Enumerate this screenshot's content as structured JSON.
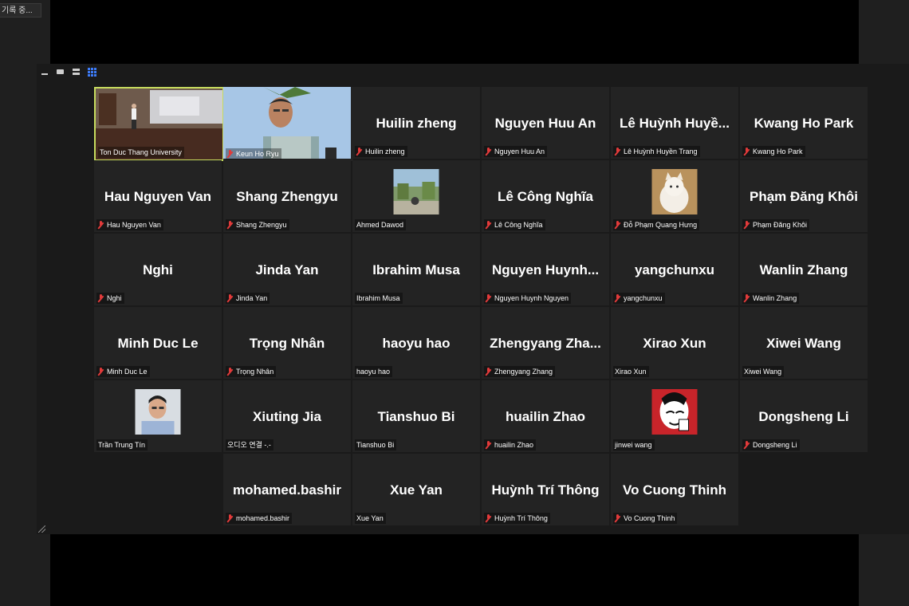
{
  "recording_badge": "기록 중...",
  "window": {
    "view_controls": [
      "minimize",
      "speaker-view",
      "strip-view",
      "gallery-view"
    ]
  },
  "participants": [
    {
      "name": "Ton Duc Thang University",
      "big": "",
      "muted": false,
      "video": "classroom",
      "active": true
    },
    {
      "name": "Keun Ho Ryu",
      "big": "",
      "muted": true,
      "video": "man-outdoor"
    },
    {
      "name": "Huilin zheng",
      "big": "Huilin zheng",
      "muted": true
    },
    {
      "name": "Nguyen Huu An",
      "big": "Nguyen Huu An",
      "muted": true
    },
    {
      "name": "Lê Huỳnh Huyền Trang",
      "big": "Lê Huỳnh Huyề...",
      "muted": true
    },
    {
      "name": "Kwang Ho Park",
      "big": "Kwang Ho Park",
      "muted": true
    },
    {
      "name": "Hau Nguyen Van",
      "big": "Hau Nguyen Van",
      "muted": true
    },
    {
      "name": "Shang Zhengyu",
      "big": "Shang Zhengyu",
      "muted": true
    },
    {
      "name": "Ahmed Dawod",
      "big": "",
      "muted": false,
      "thumb": "garden"
    },
    {
      "name": "Lê Công Nghĩa",
      "big": "Lê Công Nghĩa",
      "muted": true
    },
    {
      "name": "Đỗ Phạm Quang Hưng",
      "big": "",
      "muted": true,
      "thumb": "cat"
    },
    {
      "name": "Phạm Đăng Khôi",
      "big": "Phạm Đăng Khôi",
      "muted": true
    },
    {
      "name": "Nghi",
      "big": "Nghi",
      "muted": true
    },
    {
      "name": "Jinda Yan",
      "big": "Jinda Yan",
      "muted": true
    },
    {
      "name": "Ibrahim Musa",
      "big": "Ibrahim Musa",
      "muted": false
    },
    {
      "name": "Nguyen Huynh Nguyen",
      "big": "Nguyen  Huynh...",
      "muted": true
    },
    {
      "name": "yangchunxu",
      "big": "yangchunxu",
      "muted": true
    },
    {
      "name": "Wanlin Zhang",
      "big": "Wanlin Zhang",
      "muted": true
    },
    {
      "name": "Minh Duc Le",
      "big": "Minh Duc Le",
      "muted": true
    },
    {
      "name": "Trọng Nhân",
      "big": "Trọng Nhân",
      "muted": true
    },
    {
      "name": "haoyu hao",
      "big": "haoyu hao",
      "muted": false
    },
    {
      "name": "Zhengyang Zhang",
      "big": "Zhengyang  Zha...",
      "muted": true
    },
    {
      "name": "Xirao Xun",
      "big": "Xirao Xun",
      "muted": false
    },
    {
      "name": "Xiwei Wang",
      "big": "Xiwei Wang",
      "muted": false
    },
    {
      "name": "Trần Trung Tín",
      "big": "",
      "muted": false,
      "thumb": "man-portrait"
    },
    {
      "name": "오디오 연결 -.-",
      "big": "Xiuting Jia",
      "muted": false
    },
    {
      "name": "Tianshuo Bi",
      "big": "Tianshuo Bi",
      "muted": false
    },
    {
      "name": "huailin Zhao",
      "big": "huailin Zhao",
      "muted": true
    },
    {
      "name": "jinwei wang",
      "big": "",
      "muted": false,
      "thumb": "cartoon-red"
    },
    {
      "name": "Dongsheng Li",
      "big": "Dongsheng Li",
      "muted": true
    },
    {
      "name": "mohamed.bashir",
      "big": "mohamed.bashir",
      "muted": true
    },
    {
      "name": "Xue Yan",
      "big": "Xue Yan",
      "muted": false
    },
    {
      "name": "Huỳnh Trí Thông",
      "big": "Huỳnh Trí Thông",
      "muted": true
    },
    {
      "name": "Vo Cuong Thinh",
      "big": "Vo Cuong Thinh",
      "muted": true
    }
  ],
  "colors": {
    "active_border": "#c7dc5e",
    "muted_icon": "#e23a3a",
    "tile_bg": "#232323",
    "grid_icon": "#3d7bf7"
  }
}
